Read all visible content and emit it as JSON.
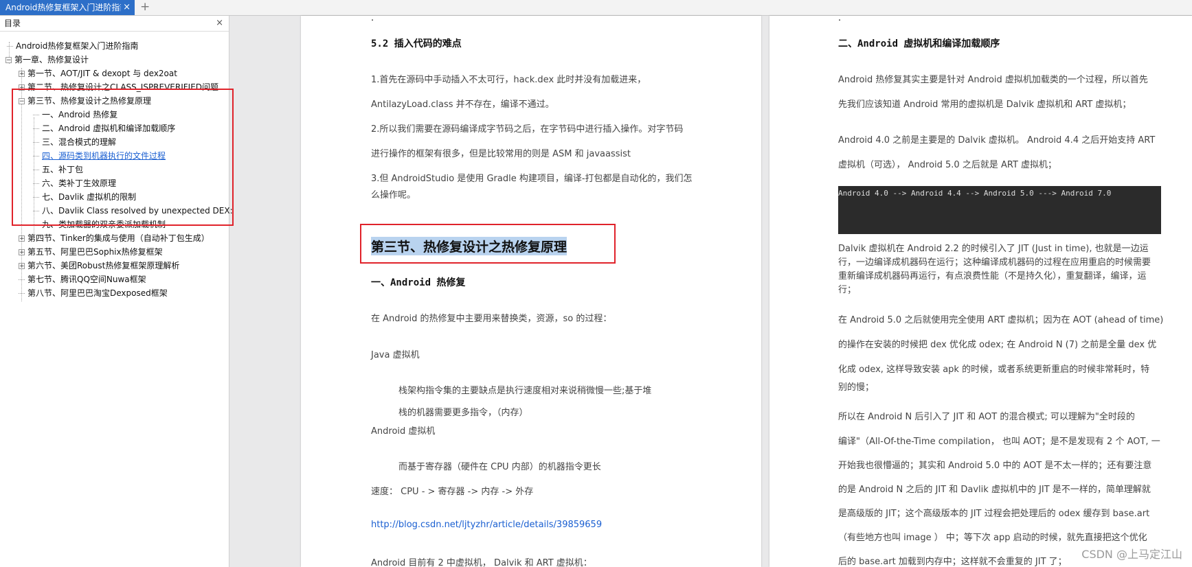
{
  "tabbar": {
    "tab_title": "Android热修复框架入门进阶指南",
    "close": "×",
    "add": "+"
  },
  "sidebar": {
    "title": "目录",
    "close": "×",
    "items": [
      "Android热修复框架入门进阶指南",
      "第一章、热修复设计",
      "第一节、AOT/JIT & dexopt 与 dex2oat",
      "第二节、热修复设计之CLASS_ISPREVERIFIED问题",
      "第三节、热修复设计之热修复原理",
      "一、Android 热修复",
      "二、Android 虚拟机和编译加载顺序",
      "三、混合模式的理解",
      "四、源码类到机器执行的文件过程",
      "五、补丁包",
      "六、类补丁生效原理",
      "七、Davlik 虚拟机的限制",
      "八、Davlik Class resolved by unexpected DEX:",
      "九、类加载器的双亲委派加载机制",
      "第四节、Tinker的集成与使用（自动补丁包生成）",
      "第五节、阿里巴巴Sophix热修复框架",
      "第六节、美团Robust热修复框架原理解析",
      "第七节、腾讯QQ空间Nuwa框架",
      "第八节、阿里巴巴淘宝Dexposed框架"
    ]
  },
  "page1": {
    "dot": "·",
    "h52": "5.2  插入代码的难点",
    "l1": "1.首先在源码中手动插入不太可行，hack.dex 此时并没有加载进来，",
    "l2": "AntilazyLoad.class 并不存在，编译不通过。",
    "l3": "2.所以我们需要在源码编译成字节码之后，在字节码中进行插入操作。对字节码",
    "l4": "进行操作的框架有很多，但是比较常用的则是 ASM 和 javaassist",
    "l5": "3.但 AndroidStudio 是使用 Gradle 构建项目，编译-打包都是自动化的，我们怎",
    "l6": "么操作呢。",
    "section_title": "第三节、热修复设计之热修复原理",
    "h_android": "一、Android 热修复",
    "l7": "在 Android 的热修复中主要用来替换类，资源，so 的过程：",
    "l8": "Java  虚拟机",
    "l9": "栈架构指令集的主要缺点是执行速度相对来说稍微慢一些;基于堆",
    "l10": "栈的机器需要更多指令，（内存）",
    "l11": "Android  虚拟机",
    "l12": "而基于寄存器（硬件在 CPU 内部）的机器指令更长",
    "l13": "速度：  CPU - >  寄存器  ->  内存  ->  外存",
    "link": "http://blog.csdn.net/ljtyzhr/article/details/39859659",
    "l14": "Android  目前有 2 中虚拟机，  Dalvik  和  ART  虚拟机："
  },
  "page2": {
    "dot": "·",
    "h2": "二、Android 虚拟机和编译加载顺序",
    "l1": "Android  热修复其实主要是针对  Android  虚拟机加载类的一个过程，所以首先",
    "l2": "先我们应该知道  Android  常用的虚拟机是  Dalvik  虚拟机和  ART  虚拟机；",
    "l3": "Android 4.0  之前是主要是的  Dalvik  虚拟机。  Android 4.4  之后开始支持  ART",
    "l4": "虚拟机（可选），  Android 5.0  之后就是  ART  虚拟机；",
    "code": "Android 4.0 --> Android 4.4 --> Android 5.0 ---> Android 7.0",
    "l5": "Dalvik  虚拟机在  Android 2.2  的时候引入了  JIT (Just in time),  也就是一边运",
    "l6": "行，一边编译成机器码在运行；这种编译成机器码的过程在应用重启的时候需要",
    "l7": "重新编译成机器码再运行，有点浪费性能（不是持久化），重复翻译，编译，运",
    "l8": "行；",
    "l9": "在  Android 5.0  之后就使用完全使用  ART  虚拟机；因为在  AOT (ahead of time)",
    "l10": "的操作在安装的时候把  dex  优化成 odex;  在 Android N (7)  之前是全量 dex  优",
    "l11": "化成  odex, 这样导致安装  apk  的时候，或者系统更新重启的时候非常耗时，特",
    "l12": "别的慢；",
    "l13": "所以在  Android N  后引入了  JIT  和  AOT  的混合模式; 可以理解为\"全时段的",
    "l14": "编译\"（All-Of-the-Time compilation，  也叫  AOT；是不是发现有 2 个  AOT, 一",
    "l15": "开始我也很懵逼的；其实和 Android 5.0  中的  AOT  是不太一样的；还有要注意",
    "l16": "的是 Android N  之后的  JIT  和  Davlik  虚拟机中的 JIT 是不一样的，简单理解就",
    "l17": "是高级版的 JIT；这个高级版本的  JIT  过程会把处理后的 odex 缓存到  base.art",
    "l18": "（有些地方也叫  image  ）  中；等下次 app 启动的时候，就先直接把这个优化",
    "l19": "后的  base.art  加载到内存中；这样就不会重复的  JIT 了；"
  },
  "watermark": "CSDN @上马定江山",
  "colors": {
    "tab_active": "#2d6fc8",
    "highlight_box": "#e0222a",
    "link": "#1a5fd1"
  }
}
